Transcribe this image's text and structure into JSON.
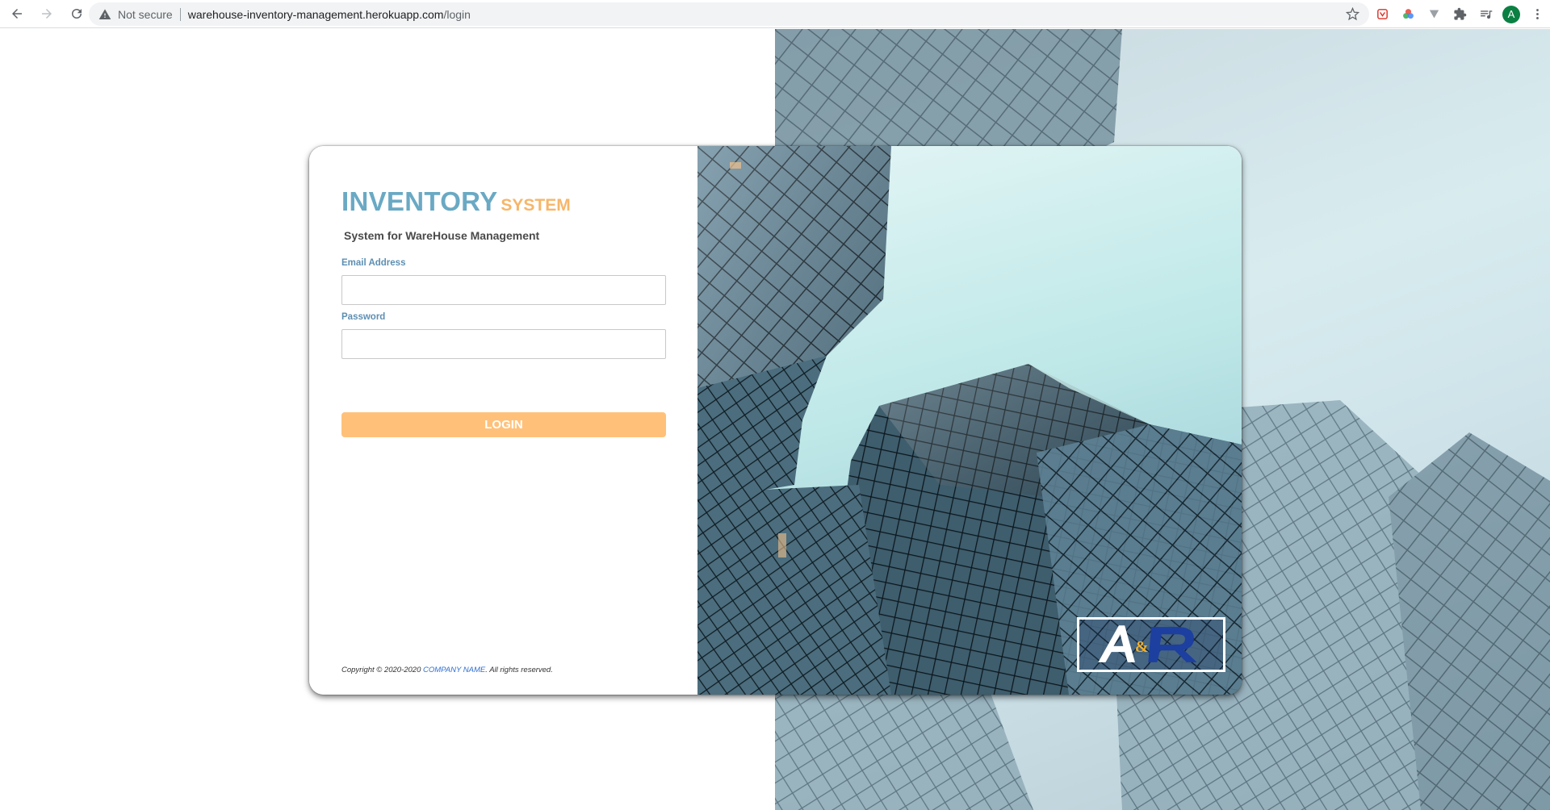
{
  "browser": {
    "not_secure": "Not secure",
    "url_host": "warehouse-inventory-management.herokuapp.com",
    "url_path": "/login",
    "profile_initial": "A",
    "icons": [
      "back-icon",
      "forward-icon",
      "reload-icon",
      "warning-icon",
      "bookmark-star-icon",
      "extension-shield-icon",
      "color-wheel-icon",
      "vee-extension-icon",
      "puzzle-extensions-icon",
      "reading-list-icon",
      "menu-kebab-icon"
    ]
  },
  "brand": {
    "main": "INVENTORY",
    "sub": "SYSTEM",
    "tagline": "System for WareHouse Management",
    "main_color": "#6aa9c4",
    "sub_color": "#f6b66a"
  },
  "form": {
    "email_label": "Email Address",
    "email_value": "",
    "password_label": "Password",
    "password_value": "",
    "login_label": "LOGIN",
    "login_color": "#ffc179"
  },
  "footer": {
    "copyright_prefix": "Copyright © 2020-2020 ",
    "company": "COMPANY NAME",
    "copyright_suffix": ". All rights reserved."
  },
  "logo": {
    "letters": "A&R"
  }
}
